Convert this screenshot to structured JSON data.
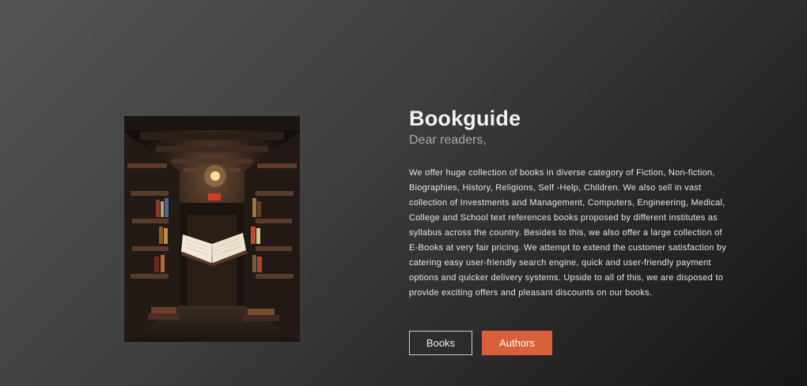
{
  "hero": {
    "image_name": "library-open-book-photo",
    "title": "Bookguide",
    "subtitle": "Dear readers,",
    "description": "We offer huge collection of books in diverse category of Fiction, Non-fiction, Biographies, History, Religions, Self -Help, Children. We also sell in vast collection of Investments and Management, Computers, Engineering, Medical, College and School text references books proposed by different institutes as syllabus across the country. Besides to this, we also offer a large collection of E-Books at very fair pricing. We attempt to extend the customer satisfaction by catering easy user-friendly search engine, quick and user-friendly payment options and quicker delivery systems. Upside to all of this, we are disposed to provide exciting offers and pleasant discounts on our books."
  },
  "buttons": {
    "books_label": "Books",
    "authors_label": "Authors"
  },
  "colors": {
    "accent": "#d9603a",
    "background_light": "#545454",
    "background_dark": "#161616",
    "title": "#f2f2f2",
    "subtitle": "#a8a8a8"
  }
}
